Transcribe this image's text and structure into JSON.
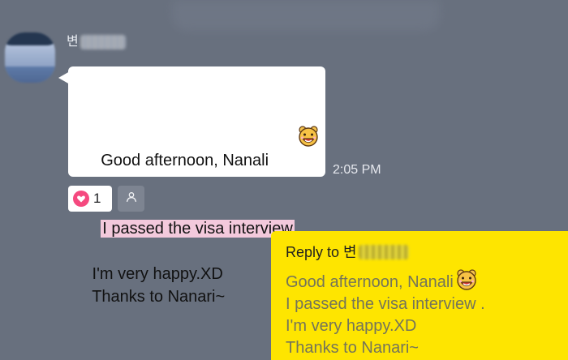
{
  "chat": {
    "incoming": {
      "sender_prefix": "변",
      "lines": [
        "Good afternoon, Nanali",
        "I passed the visa interview",
        " .",
        " I'm very happy.XD",
        " Thanks to Nanari~"
      ],
      "timestamp": "2:05 PM",
      "reaction": {
        "count": "1"
      }
    },
    "reply": {
      "label": "Reply to",
      "sender_prefix": "변",
      "quoted_lines": [
        "Good afternoon, Nanali",
        "I passed the visa interview .",
        " I'm very happy.XD",
        " Thanks to Nanari~"
      ]
    }
  },
  "icons": {
    "emoji": "smiling-rabbit-emoji",
    "heart": "heart-icon",
    "person": "person-icon"
  },
  "colors": {
    "background": "#68707e",
    "incoming_bubble": "#ffffff",
    "highlight": "#f3c9dc",
    "reply_bubble": "#fee500",
    "reaction_heart": "#f5497f"
  }
}
